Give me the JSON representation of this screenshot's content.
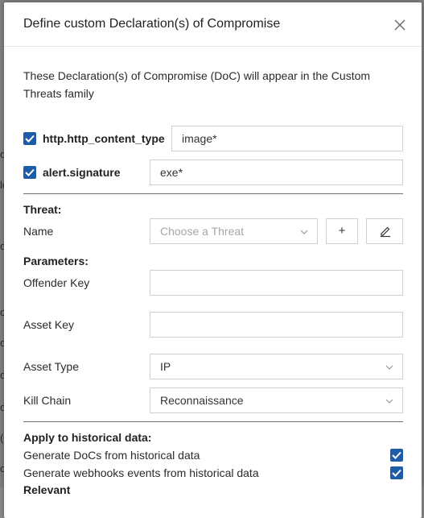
{
  "background": {
    "fragments": [
      "ow",
      "le",
      "ow",
      "ow",
      "ow",
      "ow",
      "ow",
      "(",
      "ow"
    ]
  },
  "modal": {
    "title": "Define custom Declaration(s) of Compromise",
    "intro": "These Declaration(s) of Compromise (DoC) will appear in the Custom Threats family",
    "conditions": [
      {
        "field": "http.http_content_type",
        "value": "image*",
        "checked": true
      },
      {
        "field": "alert.signature",
        "value": "exe*",
        "checked": true
      }
    ],
    "threat": {
      "heading": "Threat:",
      "name_label": "Name",
      "name_placeholder": "Choose a Threat",
      "add_label": "+"
    },
    "parameters": {
      "heading": "Parameters:",
      "offender_key_label": "Offender Key",
      "offender_key_value": "",
      "asset_key_label": "Asset Key",
      "asset_key_value": "",
      "asset_type_label": "Asset Type",
      "asset_type_value": "IP",
      "kill_chain_label": "Kill Chain",
      "kill_chain_value": "Reconnaissance"
    },
    "historical": {
      "heading": "Apply to historical data:",
      "generate_docs_label": "Generate DoCs from historical data",
      "generate_docs_checked": true,
      "generate_webhooks_label": "Generate webhooks events from historical data",
      "generate_webhooks_checked": true,
      "next_heading_partial": "Relevant"
    }
  },
  "colors": {
    "accent": "#1f5ca8",
    "overlay": "#7f7f7f"
  }
}
